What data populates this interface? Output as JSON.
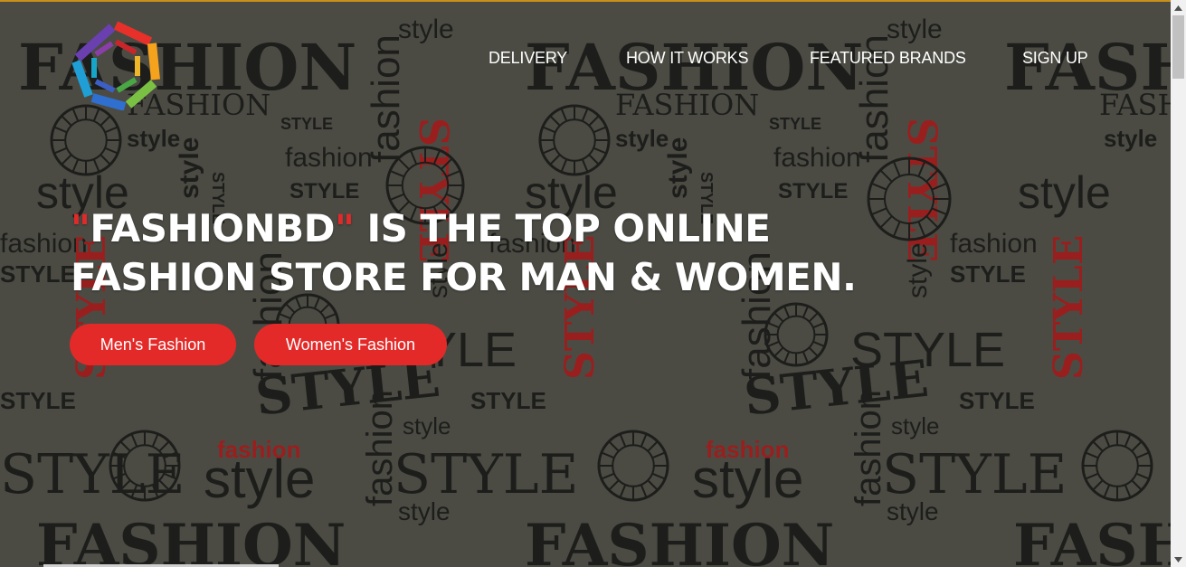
{
  "nav": {
    "items": [
      {
        "label": "DELIVERY"
      },
      {
        "label": "HOW IT WORKS"
      },
      {
        "label": "FEATURED BRANDS"
      },
      {
        "label": "SIGN UP"
      }
    ]
  },
  "hero": {
    "quote_open": "\"",
    "brand": "FASHIONBD",
    "quote_close": "\"",
    "line1_rest": " IS THE TOP ONLINE",
    "line2": "FASHION STORE FOR MAN & WOMEN.",
    "buttons": {
      "men": "Men's Fashion",
      "women": "Women's Fashion"
    }
  },
  "pattern_words": [
    "FASHION",
    "STYLE",
    "style",
    "fashion"
  ],
  "colors": {
    "accent": "#e32a28",
    "background": "#54544c",
    "text": "#ffffff",
    "pattern_dark": "#1c1c1a",
    "pattern_red": "#b31e1e"
  },
  "icons": {
    "logo": "hexagon-rainbow-logo-icon",
    "scroll_up": "triangle-up-icon",
    "scroll_down": "triangle-down-icon"
  }
}
